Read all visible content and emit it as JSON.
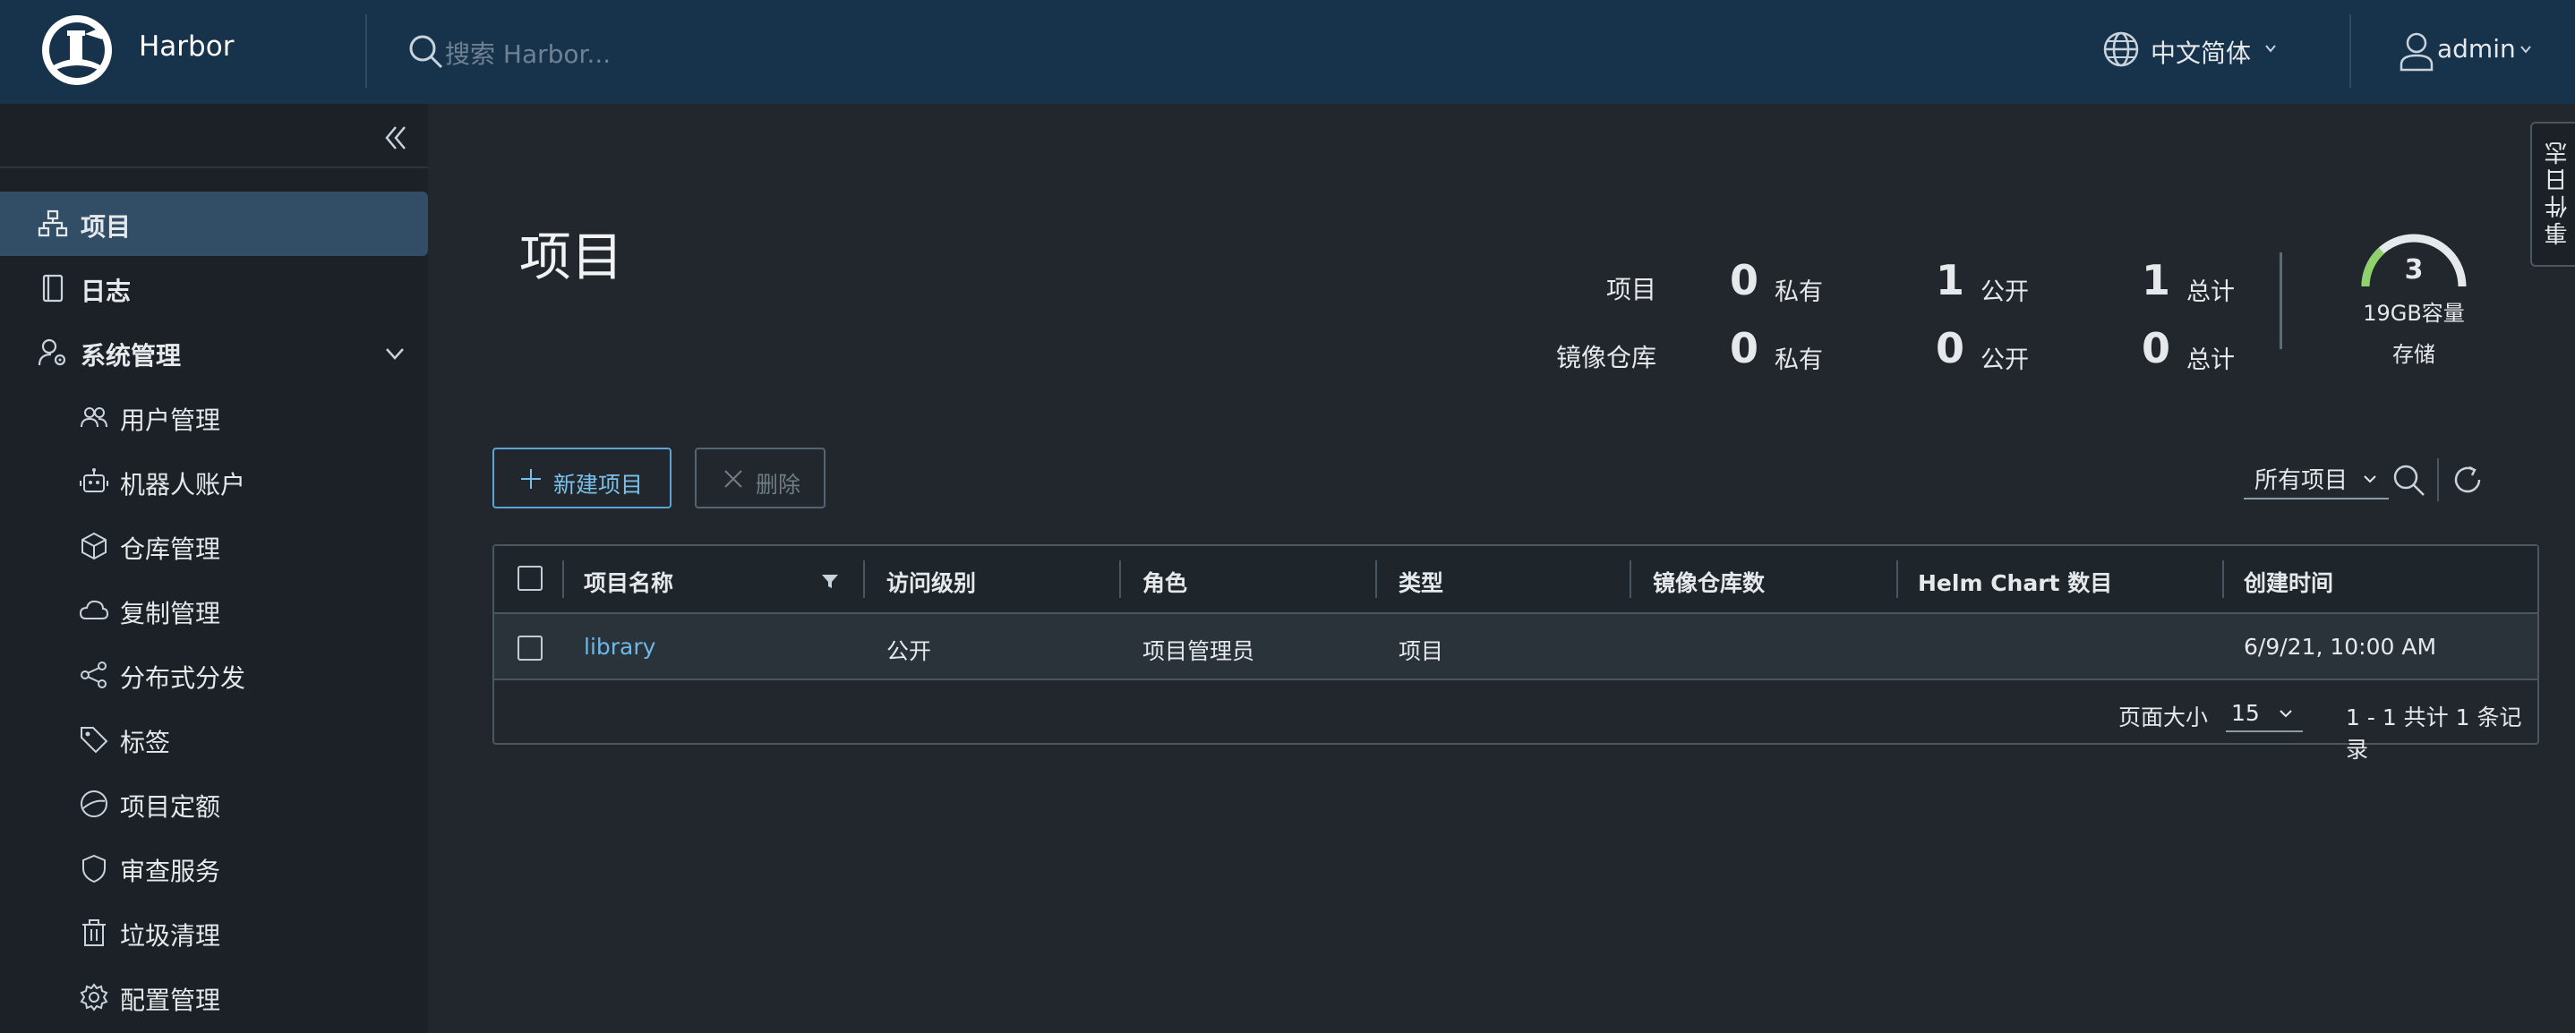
{
  "header": {
    "brand": "Harbor",
    "search_placeholder": "搜索 Harbor...",
    "language": "中文简体",
    "user": "admin"
  },
  "sidebar": {
    "items": [
      {
        "label": "项目",
        "icon": "projects-icon",
        "active": true
      },
      {
        "label": "日志",
        "icon": "log-icon"
      },
      {
        "label": "系统管理",
        "icon": "admin-icon",
        "expanded": true
      },
      {
        "label": "用户管理",
        "icon": "users-icon"
      },
      {
        "label": "机器人账户",
        "icon": "robot-icon"
      },
      {
        "label": "仓库管理",
        "icon": "cube-icon"
      },
      {
        "label": "复制管理",
        "icon": "cloud-icon"
      },
      {
        "label": "分布式分发",
        "icon": "share-icon"
      },
      {
        "label": "标签",
        "icon": "tag-icon"
      },
      {
        "label": "项目定额",
        "icon": "quota-icon"
      },
      {
        "label": "审查服务",
        "icon": "shield-icon"
      },
      {
        "label": "垃圾清理",
        "icon": "trash-icon"
      },
      {
        "label": "配置管理",
        "icon": "gear-icon"
      }
    ]
  },
  "main": {
    "title": "项目",
    "stats": {
      "projects_label": "项目",
      "repos_label": "镜像仓库",
      "private_label": "私有",
      "public_label": "公开",
      "total_label": "总计",
      "projects_private": "0",
      "projects_public": "1",
      "projects_total": "1",
      "repos_private": "0",
      "repos_public": "0",
      "repos_total": "0"
    },
    "storage": {
      "value": "3",
      "capacity": "19GB容量",
      "label": "存储",
      "accent": "#8fd16a"
    },
    "event_log_tab": "事件日志",
    "toolbar": {
      "new_label": "新建项目",
      "delete_label": "删除",
      "filter_value": "所有项目"
    },
    "table": {
      "columns": [
        "项目名称",
        "访问级别",
        "角色",
        "类型",
        "镜像仓库数",
        "Helm Chart 数目",
        "创建时间"
      ],
      "rows": [
        {
          "name": "library",
          "access": "公开",
          "role": "项目管理员",
          "type": "项目",
          "repos": "",
          "charts": "",
          "created": "6/9/21, 10:00 AM"
        }
      ],
      "page_size_label": "页面大小",
      "page_size": "15",
      "count_text": "1 - 1 共计 1 条记录"
    }
  },
  "colors": {
    "header_bg": "#17334b",
    "sidebar_bg": "#1b2126",
    "active_bg": "#324e66",
    "link": "#6eb7e8",
    "primary_border": "#5aa5d5"
  }
}
